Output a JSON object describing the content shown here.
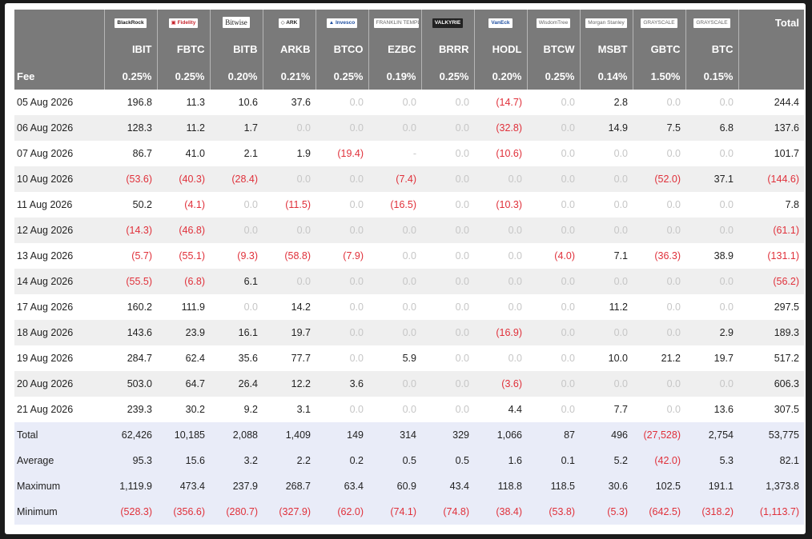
{
  "header": {
    "logos": [
      {
        "text": "BlackRock",
        "style": "plain"
      },
      {
        "text": "▣ Fidelity",
        "style": "red"
      },
      {
        "text": "Bitwise",
        "style": "serif"
      },
      {
        "text": "◇ ARK",
        "style": "plain"
      },
      {
        "text": "▲ Invesco",
        "style": "blue"
      },
      {
        "text": "FRANKLIN TEMPLETON",
        "style": "gray"
      },
      {
        "text": "VALKYRIE",
        "style": "dark"
      },
      {
        "text": "VanEck",
        "style": "blue"
      },
      {
        "text": "WisdomTree",
        "style": "gray"
      },
      {
        "text": "Morgan Stanley",
        "style": "gray"
      },
      {
        "text": "GRAYSCALE",
        "style": "gray"
      },
      {
        "text": "GRAYSCALE",
        "style": "gray"
      }
    ],
    "total_label": "Total",
    "tickers": [
      "IBIT",
      "FBTC",
      "BITB",
      "ARKB",
      "BTCO",
      "EZBC",
      "BRRR",
      "HODL",
      "BTCW",
      "MSBT",
      "GBTC",
      "BTC"
    ],
    "fee_label": "Fee",
    "fees": [
      "0.25%",
      "0.25%",
      "0.20%",
      "0.21%",
      "0.25%",
      "0.19%",
      "0.25%",
      "0.20%",
      "0.25%",
      "0.14%",
      "1.50%",
      "0.15%"
    ]
  },
  "rows": [
    {
      "date": "05 Aug 2026",
      "values": [
        "196.8",
        "11.3",
        "10.6",
        "37.6",
        "0.0",
        "0.0",
        "0.0",
        "(14.7)",
        "0.0",
        "2.8",
        "0.0",
        "0.0"
      ],
      "total": "244.4"
    },
    {
      "date": "06 Aug 2026",
      "values": [
        "128.3",
        "11.2",
        "1.7",
        "0.0",
        "0.0",
        "0.0",
        "0.0",
        "(32.8)",
        "0.0",
        "14.9",
        "7.5",
        "6.8"
      ],
      "total": "137.6"
    },
    {
      "date": "07 Aug 2026",
      "values": [
        "86.7",
        "41.0",
        "2.1",
        "1.9",
        "(19.4)",
        "-",
        "0.0",
        "(10.6)",
        "0.0",
        "0.0",
        "0.0",
        "0.0"
      ],
      "total": "101.7"
    },
    {
      "date": "10 Aug 2026",
      "values": [
        "(53.6)",
        "(40.3)",
        "(28.4)",
        "0.0",
        "0.0",
        "(7.4)",
        "0.0",
        "0.0",
        "0.0",
        "0.0",
        "(52.0)",
        "37.1"
      ],
      "total": "(144.6)"
    },
    {
      "date": "11 Aug 2026",
      "values": [
        "50.2",
        "(4.1)",
        "0.0",
        "(11.5)",
        "0.0",
        "(16.5)",
        "0.0",
        "(10.3)",
        "0.0",
        "0.0",
        "0.0",
        "0.0"
      ],
      "total": "7.8"
    },
    {
      "date": "12 Aug 2026",
      "values": [
        "(14.3)",
        "(46.8)",
        "0.0",
        "0.0",
        "0.0",
        "0.0",
        "0.0",
        "0.0",
        "0.0",
        "0.0",
        "0.0",
        "0.0"
      ],
      "total": "(61.1)"
    },
    {
      "date": "13 Aug 2026",
      "values": [
        "(5.7)",
        "(55.1)",
        "(9.3)",
        "(58.8)",
        "(7.9)",
        "0.0",
        "0.0",
        "0.0",
        "(4.0)",
        "7.1",
        "(36.3)",
        "38.9"
      ],
      "total": "(131.1)"
    },
    {
      "date": "14 Aug 2026",
      "values": [
        "(55.5)",
        "(6.8)",
        "6.1",
        "0.0",
        "0.0",
        "0.0",
        "0.0",
        "0.0",
        "0.0",
        "0.0",
        "0.0",
        "0.0"
      ],
      "total": "(56.2)"
    },
    {
      "date": "17 Aug 2026",
      "values": [
        "160.2",
        "111.9",
        "0.0",
        "14.2",
        "0.0",
        "0.0",
        "0.0",
        "0.0",
        "0.0",
        "11.2",
        "0.0",
        "0.0"
      ],
      "total": "297.5"
    },
    {
      "date": "18 Aug 2026",
      "values": [
        "143.6",
        "23.9",
        "16.1",
        "19.7",
        "0.0",
        "0.0",
        "0.0",
        "(16.9)",
        "0.0",
        "0.0",
        "0.0",
        "2.9"
      ],
      "total": "189.3"
    },
    {
      "date": "19 Aug 2026",
      "values": [
        "284.7",
        "62.4",
        "35.6",
        "77.7",
        "0.0",
        "5.9",
        "0.0",
        "0.0",
        "0.0",
        "10.0",
        "21.2",
        "19.7"
      ],
      "total": "517.2"
    },
    {
      "date": "20 Aug 2026",
      "values": [
        "503.0",
        "64.7",
        "26.4",
        "12.2",
        "3.6",
        "0.0",
        "0.0",
        "(3.6)",
        "0.0",
        "0.0",
        "0.0",
        "0.0"
      ],
      "total": "606.3"
    },
    {
      "date": "21 Aug 2026",
      "values": [
        "239.3",
        "30.2",
        "9.2",
        "3.1",
        "0.0",
        "0.0",
        "0.0",
        "4.4",
        "0.0",
        "7.7",
        "0.0",
        "13.6"
      ],
      "total": "307.5"
    }
  ],
  "stats": [
    {
      "label": "Total",
      "values": [
        "62,426",
        "10,185",
        "2,088",
        "1,409",
        "149",
        "314",
        "329",
        "1,066",
        "87",
        "496",
        "(27,528)",
        "2,754"
      ],
      "total": "53,775"
    },
    {
      "label": "Average",
      "values": [
        "95.3",
        "15.6",
        "3.2",
        "2.2",
        "0.2",
        "0.5",
        "0.5",
        "1.6",
        "0.1",
        "5.2",
        "(42.0)",
        "5.3"
      ],
      "total": "82.1"
    },
    {
      "label": "Maximum",
      "values": [
        "1,119.9",
        "473.4",
        "237.9",
        "268.7",
        "63.4",
        "60.9",
        "43.4",
        "118.8",
        "118.5",
        "30.6",
        "102.5",
        "191.1"
      ],
      "total": "1,373.8"
    },
    {
      "label": "Minimum",
      "values": [
        "(528.3)",
        "(356.6)",
        "(280.7)",
        "(327.9)",
        "(62.0)",
        "(74.1)",
        "(74.8)",
        "(38.4)",
        "(53.8)",
        "(5.3)",
        "(642.5)",
        "(318.2)"
      ],
      "total": "(1,113.7)"
    }
  ],
  "colors": {
    "header_bg": "#7a7a7a",
    "negative": "#e0303a",
    "zero": "#c6c6c6",
    "stats_bg": "#e9ecf8",
    "stripe": "#efefef"
  }
}
